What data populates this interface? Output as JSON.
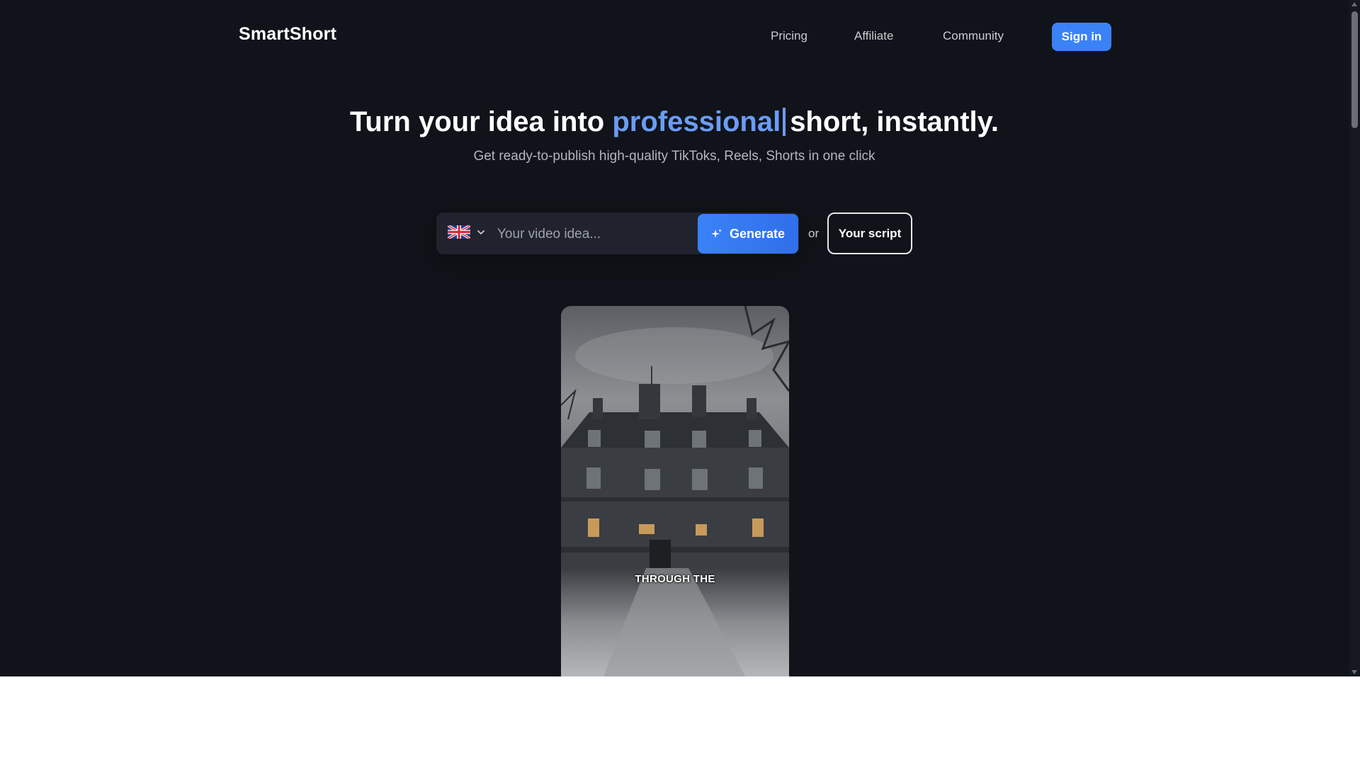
{
  "nav": {
    "brand": "SmartShort",
    "links": [
      {
        "label": "Pricing"
      },
      {
        "label": "Affiliate"
      },
      {
        "label": "Community"
      }
    ],
    "signin_label": "Sign in"
  },
  "hero": {
    "title_before": "Turn your idea into",
    "title_highlight": "professional",
    "title_after": "short, instantly.",
    "subtitle": "Get ready-to-publish high-quality TikToks, Reels, Shorts in one click"
  },
  "form": {
    "language_icon": "uk-flag-icon",
    "idea_placeholder": "Your video idea...",
    "generate_label": "Generate",
    "or_label": "or",
    "script_label": "Your script"
  },
  "video": {
    "caption": "THROUGH THE"
  },
  "colors": {
    "background": "#11131a",
    "accent": "#3b82f6",
    "highlight_text": "#6b9cf5"
  }
}
